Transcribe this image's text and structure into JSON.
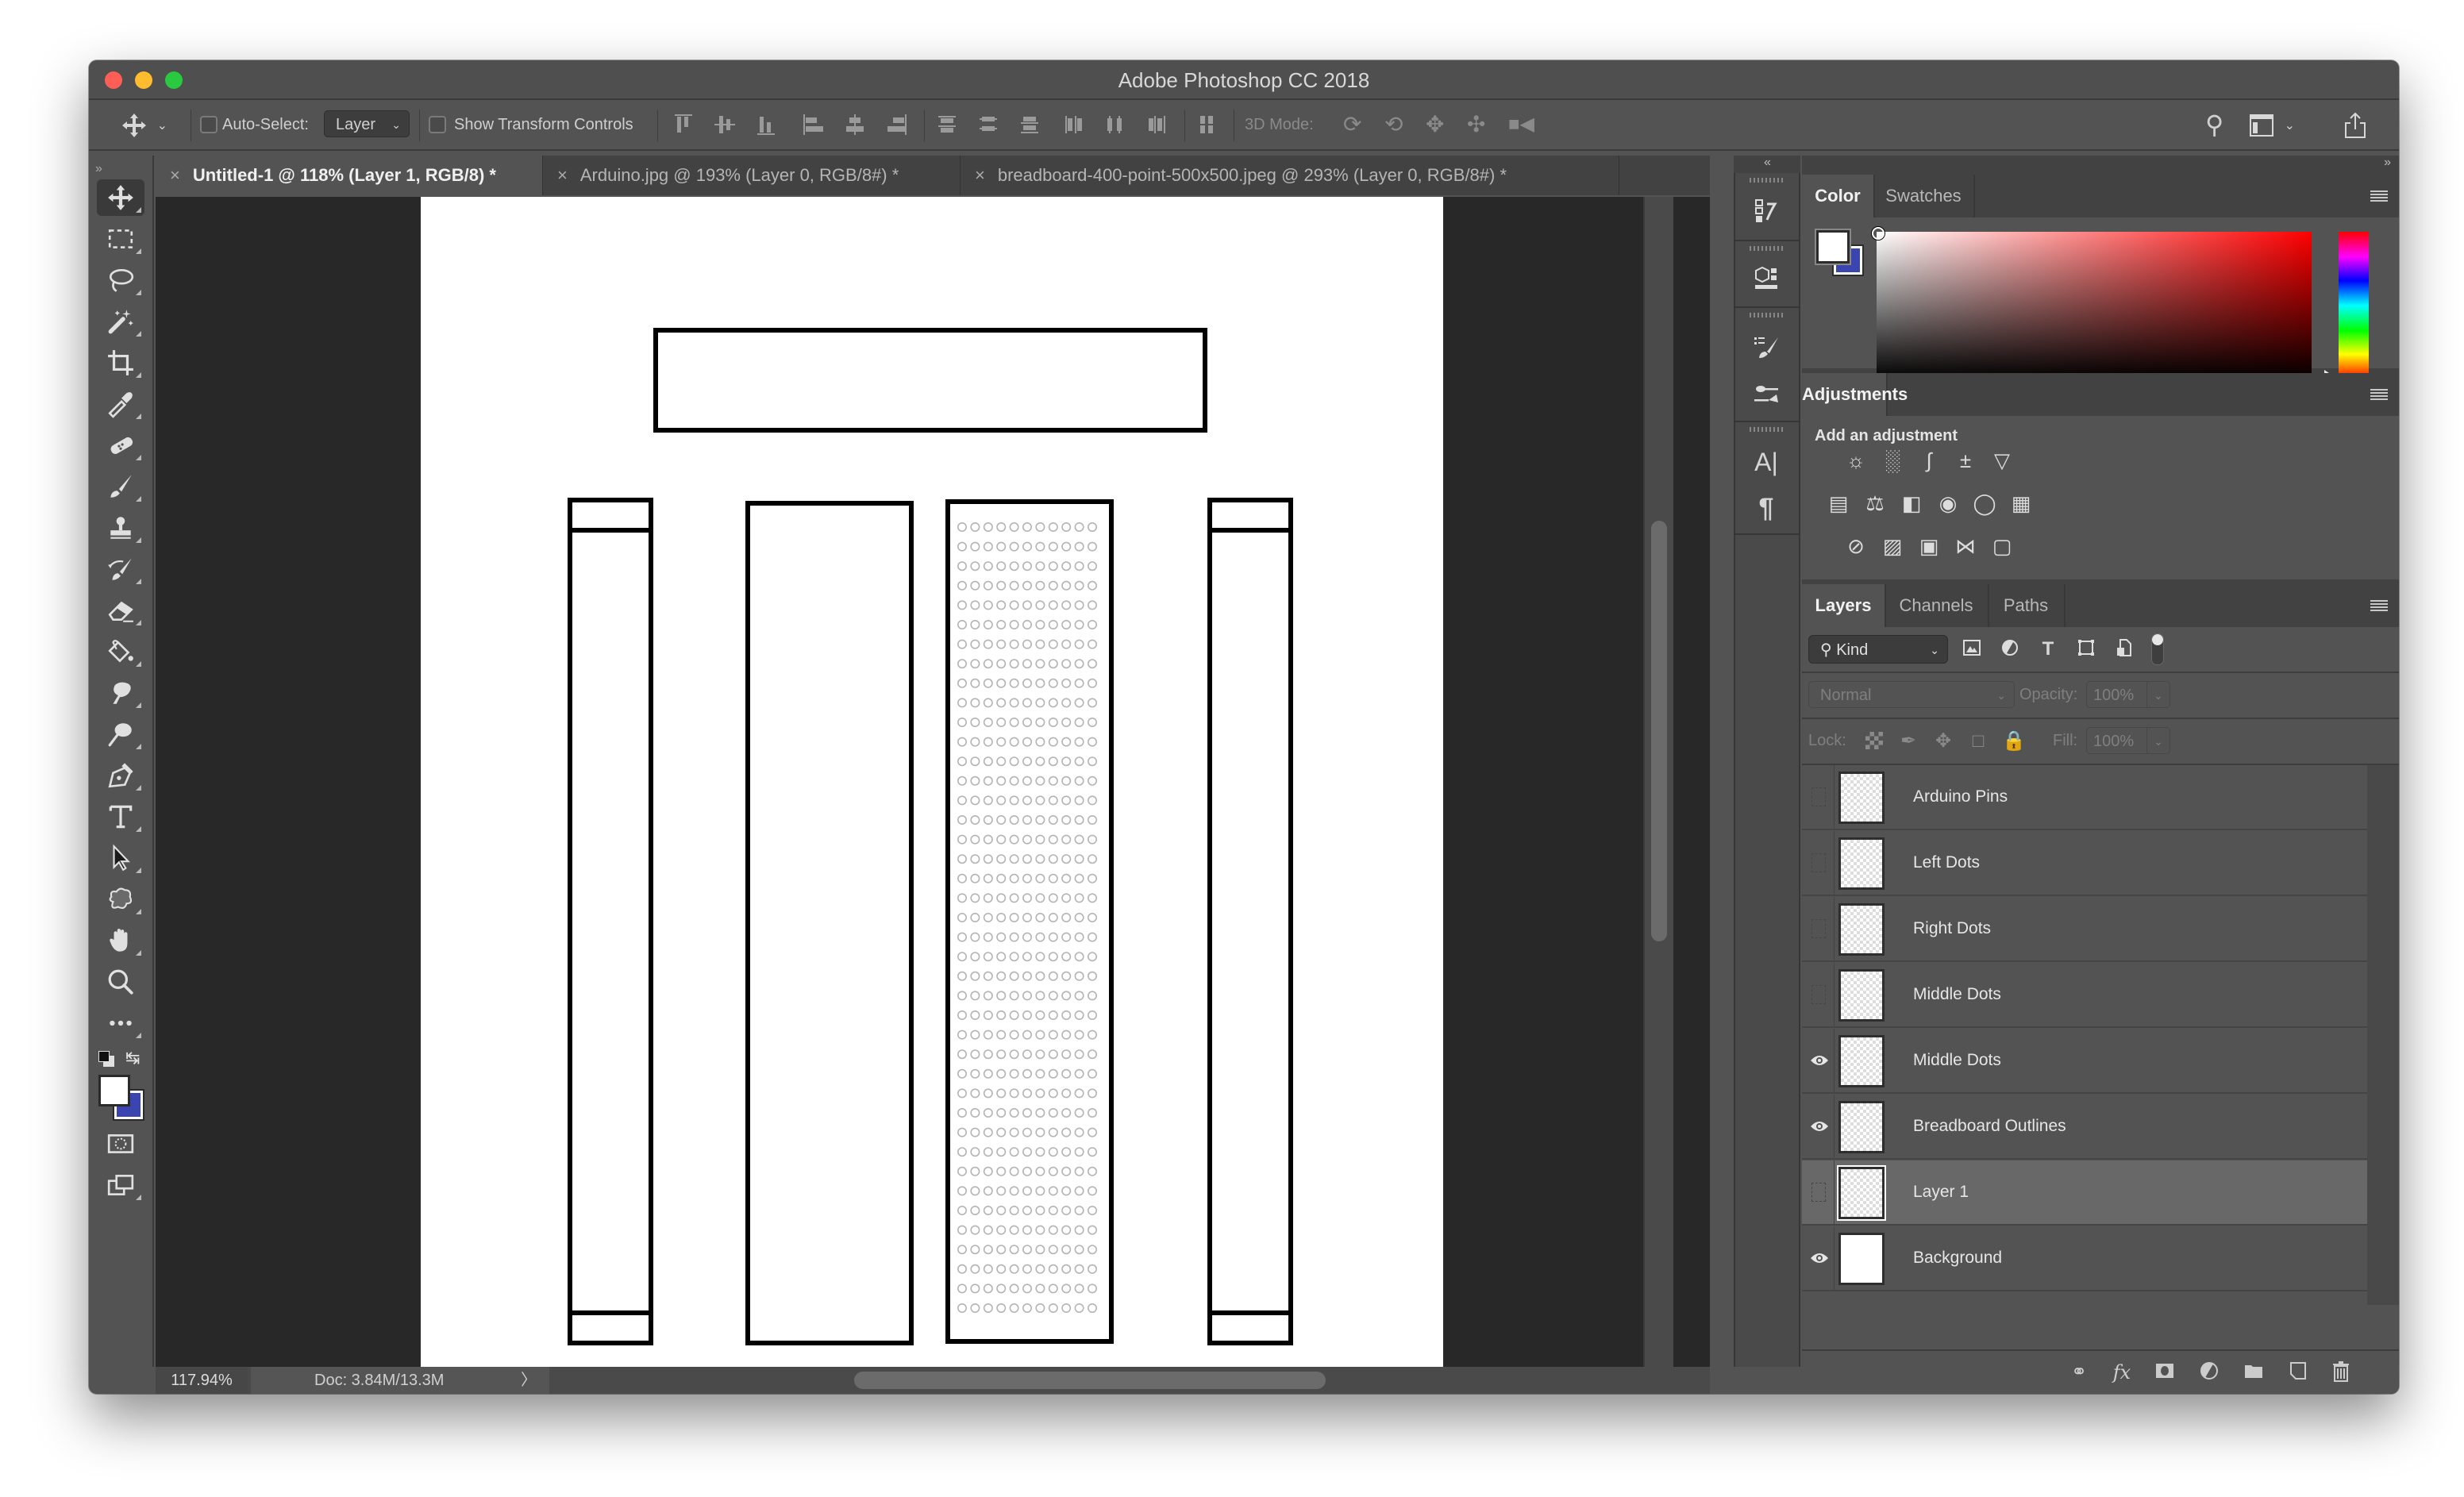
{
  "window": {
    "title": "Adobe Photoshop CC 2018"
  },
  "options_bar": {
    "auto_select_label": "Auto-Select:",
    "auto_select_checked": false,
    "auto_select_target": "Layer",
    "show_transform_label": "Show Transform Controls",
    "show_transform_checked": false,
    "mode_3d_label": "3D Mode:"
  },
  "document_tabs": [
    {
      "label": "Untitled-1 @ 118% (Layer 1, RGB/8) *",
      "active": true
    },
    {
      "label": "Arduino.jpg @ 193% (Layer 0, RGB/8#) *",
      "active": false
    },
    {
      "label": "breadboard-400-point-500x500.jpeg @ 293% (Layer 0, RGB/8#) *",
      "active": false
    }
  ],
  "tools": [
    {
      "name": "move-tool",
      "active": true
    },
    {
      "name": "rectangular-marquee-tool"
    },
    {
      "name": "lasso-tool"
    },
    {
      "name": "magic-wand-tool"
    },
    {
      "name": "crop-tool"
    },
    {
      "name": "eyedropper-tool"
    },
    {
      "name": "healing-brush-tool"
    },
    {
      "name": "brush-tool"
    },
    {
      "name": "clone-stamp-tool"
    },
    {
      "name": "history-brush-tool"
    },
    {
      "name": "eraser-tool"
    },
    {
      "name": "paint-bucket-tool"
    },
    {
      "name": "smudge-tool"
    },
    {
      "name": "dodge-tool"
    },
    {
      "name": "pen-tool"
    },
    {
      "name": "type-tool"
    },
    {
      "name": "path-selection-tool"
    },
    {
      "name": "custom-shape-tool"
    },
    {
      "name": "hand-tool"
    },
    {
      "name": "zoom-tool"
    },
    {
      "name": "edit-toolbar"
    }
  ],
  "colors": {
    "foreground": "#ffffff",
    "background": "#3b45b0"
  },
  "status_bar": {
    "zoom": "117.94%",
    "doc_info": "Doc: 3.84M/13.3M",
    "arrow": "〉"
  },
  "canvas": {
    "dot_columns": 11,
    "dot_rows": 41
  },
  "color_panel": {
    "tabs": [
      "Color",
      "Swatches"
    ],
    "active_tab": "Color"
  },
  "adjustments_panel": {
    "title": "Adjustments",
    "subtitle": "Add an adjustment",
    "rows": [
      [
        "brightness-contrast",
        "levels",
        "curves",
        "exposure",
        "vibrance"
      ],
      [
        "hue-saturation",
        "color-balance",
        "black-white",
        "photo-filter",
        "channel-mixer",
        "color-lookup"
      ],
      [
        "invert",
        "posterize",
        "threshold",
        "selective-color",
        "gradient-map"
      ]
    ]
  },
  "layers_panel": {
    "tabs": [
      "Layers",
      "Channels",
      "Paths"
    ],
    "active_tab": "Layers",
    "filter_kind": "Kind",
    "blend_mode": "Normal",
    "opacity_label": "Opacity:",
    "opacity": "100%",
    "lock_label": "Lock:",
    "fill_label": "Fill:",
    "fill": "100%",
    "layers": [
      {
        "name": "Arduino Pins",
        "visible": false,
        "selected": false
      },
      {
        "name": "Left Dots",
        "visible": false,
        "selected": false
      },
      {
        "name": "Right Dots",
        "visible": false,
        "selected": false
      },
      {
        "name": "Middle Dots",
        "visible": false,
        "selected": false
      },
      {
        "name": "Middle Dots",
        "visible": true,
        "selected": false
      },
      {
        "name": "Breadboard Outlines",
        "visible": true,
        "selected": false
      },
      {
        "name": "Layer 1",
        "visible": false,
        "selected": true
      },
      {
        "name": "Background",
        "visible": true,
        "selected": false
      }
    ]
  }
}
